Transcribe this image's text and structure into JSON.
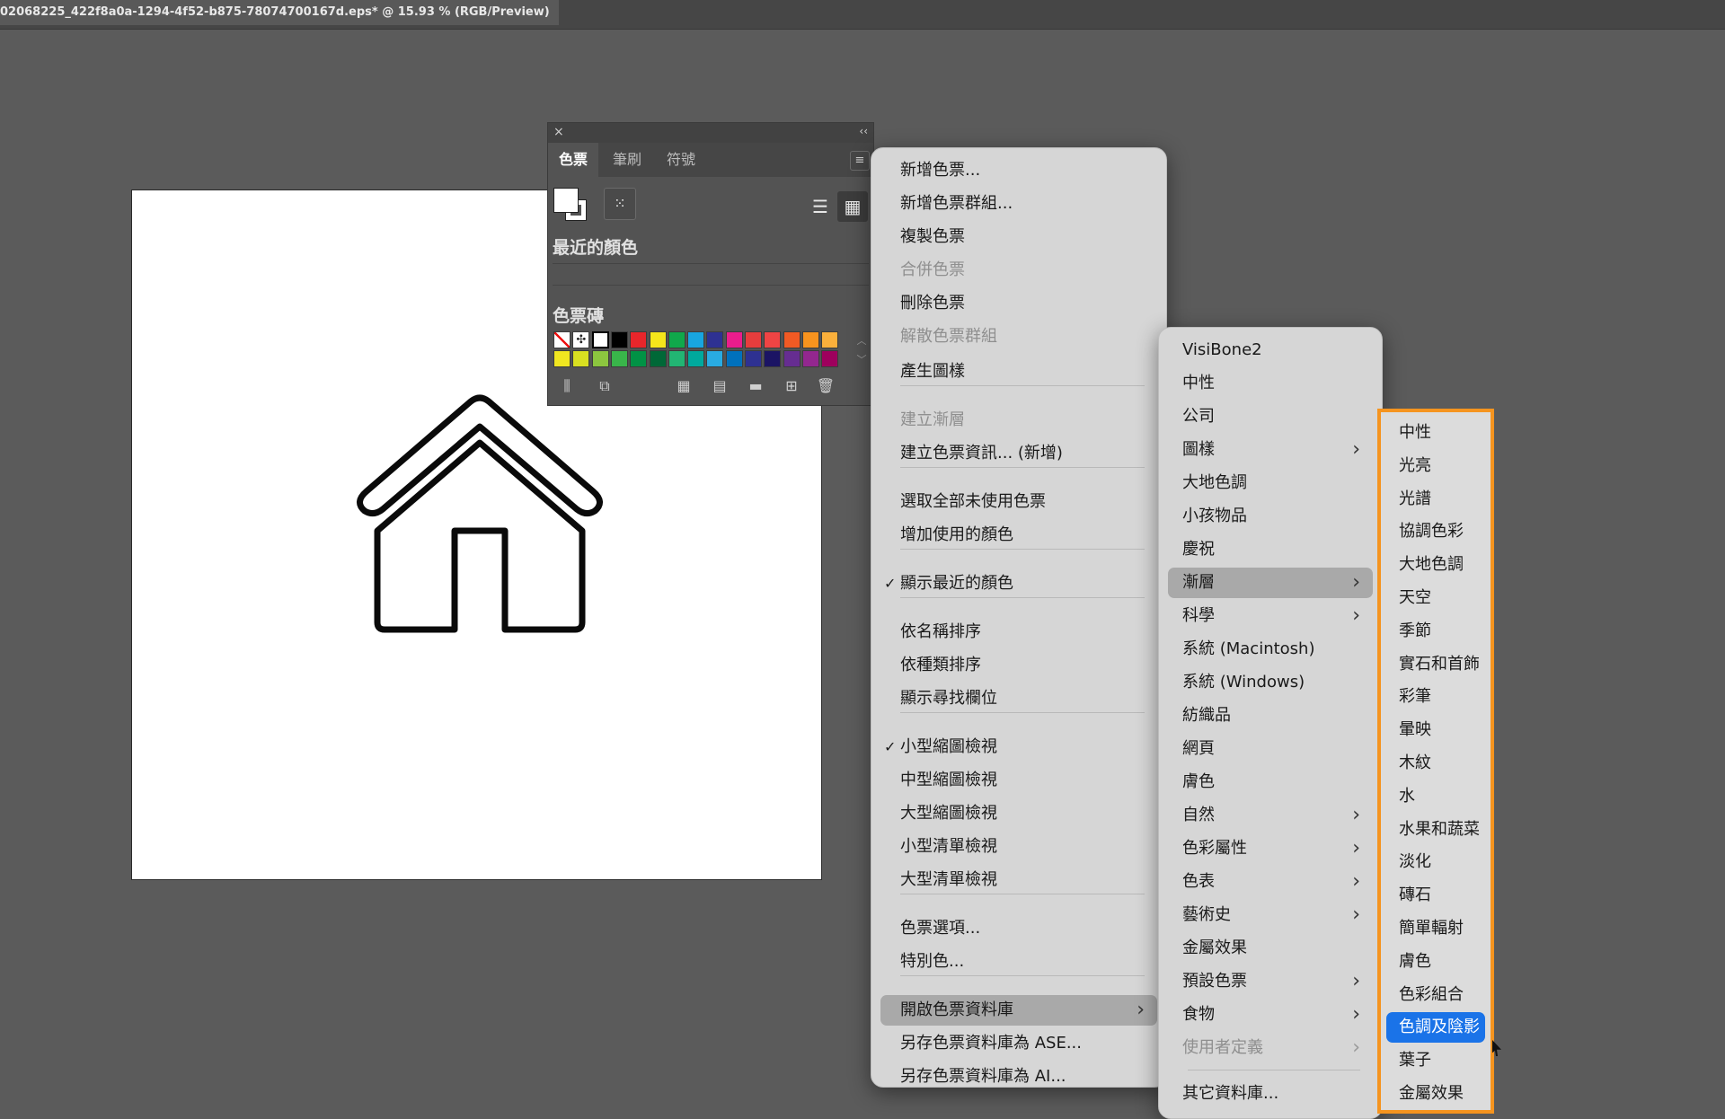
{
  "document": {
    "title": "02068225_422f8a0a-1294-4f52-b875-78074700167d.eps* @ 15.93 % (RGB/Preview)"
  },
  "swatches_panel": {
    "close_glyph": "×",
    "collapse_glyph": "‹‹",
    "tabs": [
      {
        "label": "色票",
        "active": true
      },
      {
        "label": "筆刷",
        "active": false
      },
      {
        "label": "符號",
        "active": false
      }
    ],
    "recent_colors_label": "最近的顏色",
    "swatch_bricks_label": "色票磚",
    "swatch_row1": [
      "none",
      "registration",
      "white",
      "#000000",
      "#e8262b",
      "#f5e61b",
      "#10a84b",
      "#18a6e0",
      "#2e3192",
      "#ea1d8c",
      "#e63d3d",
      "#ef4444",
      "#f15a24",
      "#f7931e",
      "#fbb03b"
    ],
    "swatch_row2": [
      "#f0e620",
      "#d9e021",
      "#8cc63f",
      "#39b54a",
      "#009245",
      "#006837",
      "#22b573",
      "#00a99d",
      "#29abe2",
      "#0071bc",
      "#2e3192",
      "#1b1464",
      "#662d91",
      "#93278f",
      "#9e005d"
    ]
  },
  "main_menu": {
    "items": [
      {
        "label": "新增色票...",
        "disabled": false
      },
      {
        "label": "新增色票群組...",
        "disabled": false
      },
      {
        "label": "複製色票",
        "disabled": false
      },
      {
        "label": "合併色票",
        "disabled": true
      },
      {
        "label": "刪除色票",
        "disabled": false
      },
      {
        "label": "解散色票群組",
        "disabled": true
      },
      {
        "label": "產生圖樣",
        "disabled": false
      },
      {
        "label": "建立漸層",
        "disabled": true
      },
      {
        "label": "建立色票資訊... (新增)",
        "disabled": false
      },
      {
        "label": "選取全部未使用色票",
        "disabled": false
      },
      {
        "label": "增加使用的顏色",
        "disabled": false
      },
      {
        "label": "顯示最近的顏色",
        "checked": true
      },
      {
        "label": "依名稱排序",
        "disabled": false
      },
      {
        "label": "依種類排序",
        "disabled": false
      },
      {
        "label": "顯示尋找欄位",
        "disabled": false
      },
      {
        "label": "小型縮圖檢視",
        "checked": true
      },
      {
        "label": "中型縮圖檢視",
        "disabled": false
      },
      {
        "label": "大型縮圖檢視",
        "disabled": false
      },
      {
        "label": "小型清單檢視",
        "disabled": false
      },
      {
        "label": "大型清單檢視",
        "disabled": false
      },
      {
        "label": "色票選項...",
        "disabled": false
      },
      {
        "label": "特別色...",
        "disabled": false
      },
      {
        "label": "開啟色票資料庫",
        "highlight": true,
        "submenu": true
      },
      {
        "label": "另存色票資料庫為 ASE...",
        "disabled": false
      },
      {
        "label": "另存色票資料庫為 AI...",
        "disabled": false
      }
    ],
    "check_glyph": "✓",
    "arrow_glyph": "›"
  },
  "library_menu": {
    "items": [
      {
        "label": "VisiBone2"
      },
      {
        "label": "中性"
      },
      {
        "label": "公司"
      },
      {
        "label": "圖樣",
        "submenu": true
      },
      {
        "label": "大地色調"
      },
      {
        "label": "小孩物品"
      },
      {
        "label": "慶祝"
      },
      {
        "label": "漸層",
        "submenu": true,
        "highlight": true
      },
      {
        "label": "科學",
        "submenu": true
      },
      {
        "label": "系統 (Macintosh)"
      },
      {
        "label": "系統 (Windows)"
      },
      {
        "label": "紡織品"
      },
      {
        "label": "網頁"
      },
      {
        "label": "膚色"
      },
      {
        "label": "自然",
        "submenu": true
      },
      {
        "label": "色彩屬性",
        "submenu": true
      },
      {
        "label": "色表",
        "submenu": true
      },
      {
        "label": "藝術史",
        "submenu": true
      },
      {
        "label": "金屬效果"
      },
      {
        "label": "預設色票",
        "submenu": true
      },
      {
        "label": "食物",
        "submenu": true
      },
      {
        "label": "使用者定義",
        "submenu": true,
        "disabled": true
      },
      {
        "label": "其它資料庫..."
      }
    ]
  },
  "gradient_menu": {
    "items": [
      {
        "label": "中性"
      },
      {
        "label": "光亮"
      },
      {
        "label": "光譜"
      },
      {
        "label": "協調色彩"
      },
      {
        "label": "大地色調"
      },
      {
        "label": "天空"
      },
      {
        "label": "季節"
      },
      {
        "label": "實石和首飾"
      },
      {
        "label": "彩筆"
      },
      {
        "label": "暈映"
      },
      {
        "label": "木紋"
      },
      {
        "label": "水"
      },
      {
        "label": "水果和蔬菜"
      },
      {
        "label": "淡化"
      },
      {
        "label": "磚石"
      },
      {
        "label": "簡單輻射"
      },
      {
        "label": "膚色"
      },
      {
        "label": "色彩組合"
      },
      {
        "label": "色調及陰影",
        "selected": true
      },
      {
        "label": "葉子"
      },
      {
        "label": "金屬效果"
      }
    ],
    "frame_color": "#f5941f",
    "selected_color": "#1a73e8"
  }
}
